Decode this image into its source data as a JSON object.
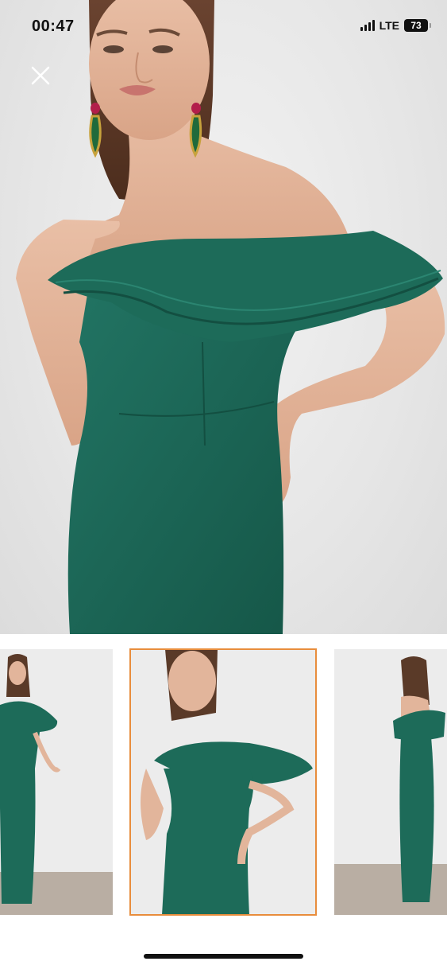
{
  "status_bar": {
    "time": "00:47",
    "network": "LTE",
    "battery": "73"
  },
  "viewer": {
    "close_icon": "close-icon",
    "selected_thumbnail": 2
  },
  "colors": {
    "dress": "#1f6b5a",
    "selected_border": "#e88d3c",
    "background": "#ffffff"
  }
}
